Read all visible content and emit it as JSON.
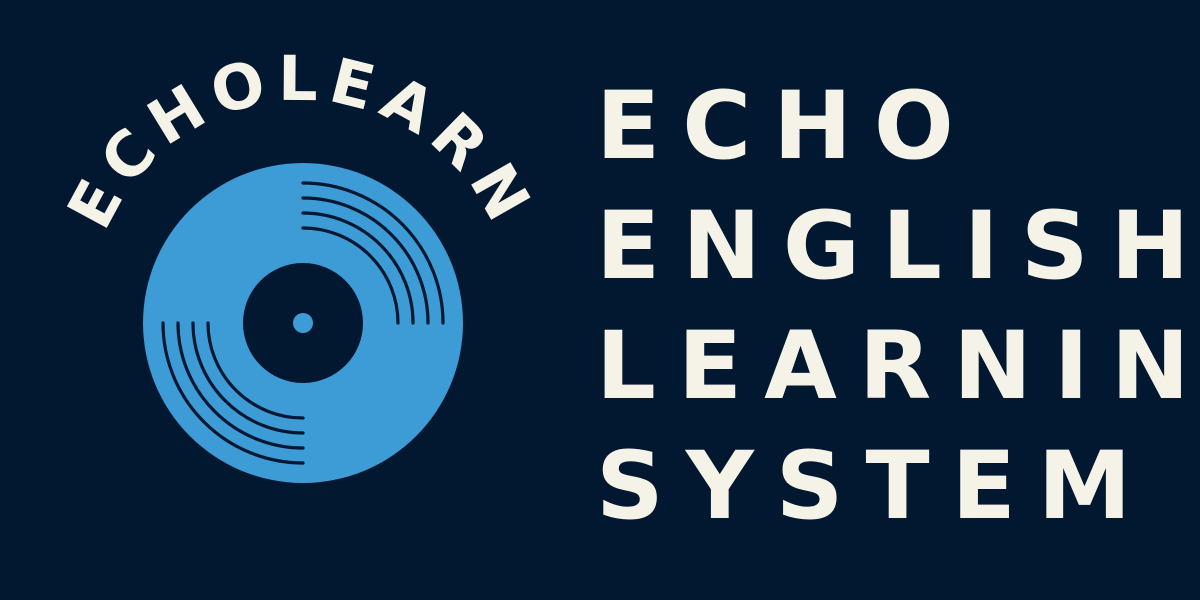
{
  "logo": {
    "arc_text": "ECHOLEARN",
    "icon": "vinyl-record-icon"
  },
  "title": {
    "lines": [
      "ECHO",
      "ENGLISH",
      "LEARNING",
      "SYSTEM"
    ]
  },
  "colors": {
    "background": "#021730",
    "disc": "#3d9bd6",
    "text": "#f5f2e8"
  }
}
